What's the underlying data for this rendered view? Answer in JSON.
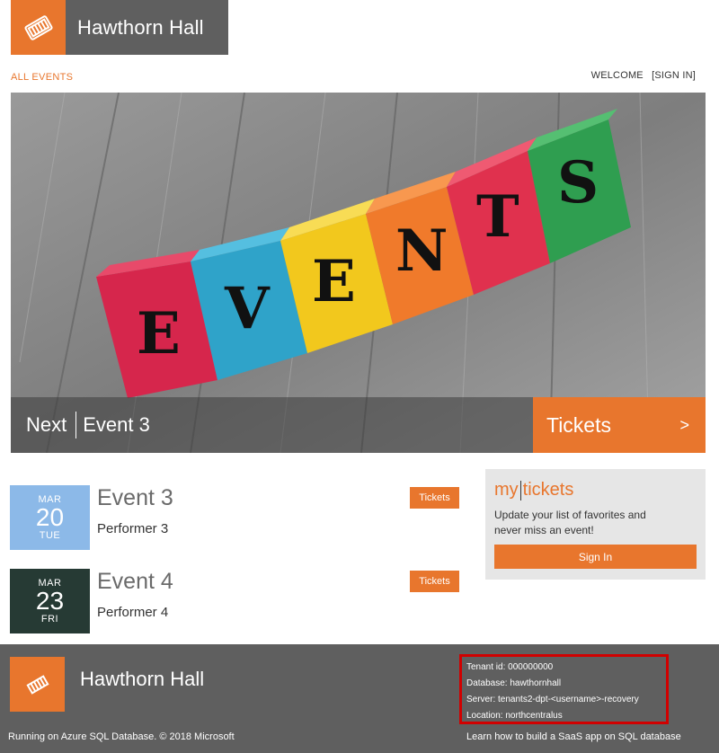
{
  "header": {
    "brand_title": "Hawthorn Hall",
    "logo_icon": "ticket-icon"
  },
  "nav": {
    "all_events": "ALL EVENTS",
    "welcome": "WELCOME",
    "sign_in": "[SIGN IN]"
  },
  "hero": {
    "next_label": "Next",
    "event_name": "Event 3",
    "tickets_label": "Tickets",
    "arrow": ">",
    "image_letters": [
      "E",
      "V",
      "E",
      "N",
      "T",
      "S"
    ]
  },
  "events": [
    {
      "month": "MAR",
      "day": "20",
      "dow": "TUE",
      "name": "Event 3",
      "performer": "Performer 3",
      "tickets_label": "Tickets",
      "color": "#8cb9e8"
    },
    {
      "month": "MAR",
      "day": "23",
      "dow": "FRI",
      "name": "Event 4",
      "performer": "Performer 4",
      "tickets_label": "Tickets",
      "color": "#263a34"
    }
  ],
  "mytickets": {
    "logo_my": "my",
    "logo_tickets": "tickets",
    "description": "Update your list of favorites and never miss an event!",
    "sign_in_label": "Sign In"
  },
  "footer": {
    "title": "Hawthorn Hall",
    "tenant_id": "Tenant id: 000000000",
    "database": "Database: hawthornhall",
    "server": "Server: tenants2-dpt-<username>-recovery",
    "location": "Location: northcentralus",
    "left_text": "Running on Azure SQL Database. © 2018 Microsoft",
    "right_text": "Learn how to build a SaaS app on SQL database"
  },
  "colors": {
    "accent": "#e8762d",
    "header_bg": "#5f5f5f",
    "highlight_border": "#d10000"
  }
}
